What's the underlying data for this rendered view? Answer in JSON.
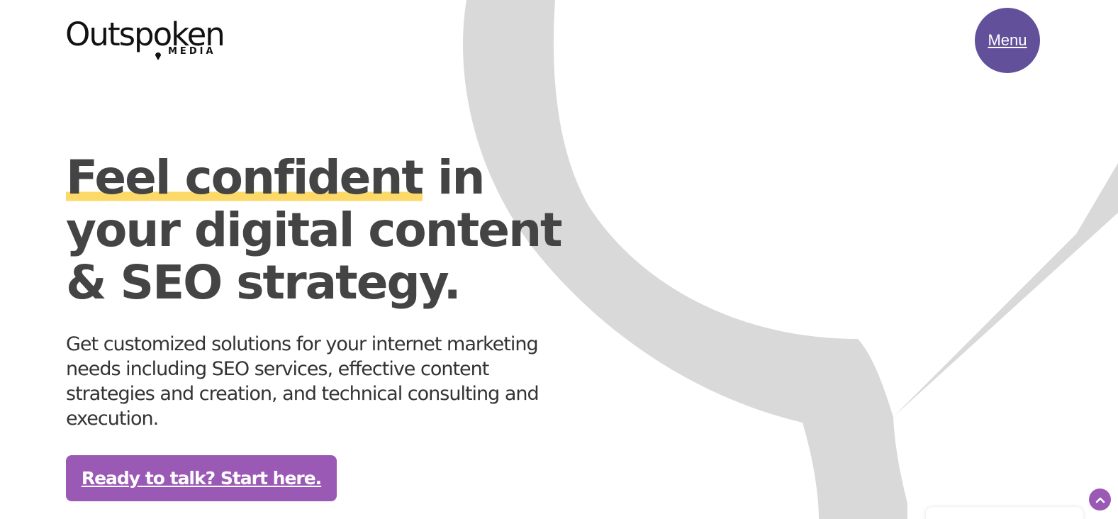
{
  "brand": {
    "logo_word": "Outspoken",
    "logo_sub": "MEDIA"
  },
  "header": {
    "menu_label": "Menu"
  },
  "hero": {
    "headline_highlight": "Feel confident",
    "headline_rest": " in your digital content & SEO strategy.",
    "subtext": "Get customized solutions for your internet marketing needs including SEO services, effective content strategies and creation, and technical consulting and execution.",
    "cta_label": "Ready to talk? Start here."
  },
  "icons": {
    "back_to_top": "chevron-up-icon",
    "background": "speech-bubble-pin-icon",
    "logo_mark": "map-pin-icon"
  },
  "colors": {
    "menu_bg": "#62509a",
    "cta_bg": "#9b59b6",
    "highlight": "#fcd968",
    "headline_text": "#444444",
    "bg_shape": "#d9d9d9"
  }
}
